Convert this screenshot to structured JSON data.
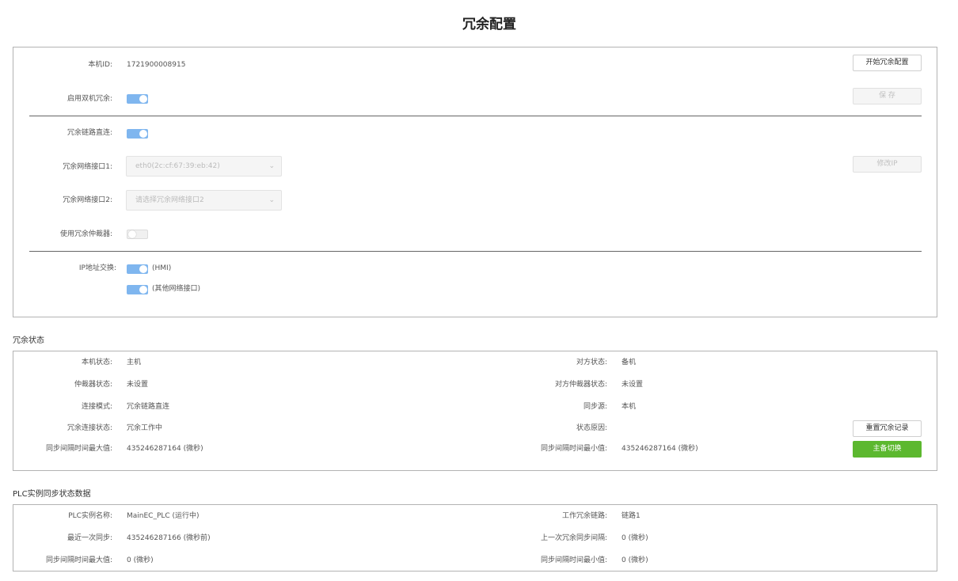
{
  "page_title": "冗余配置",
  "config": {
    "local_id_label": "本机ID:",
    "local_id_value": "1721900008915",
    "start_button": "开始冗余配置",
    "enable_label": "启用双机冗余:",
    "save_button": "保 存",
    "direct_link_label": "冗余链路直连:",
    "iface1_label": "冗余网络接口1:",
    "iface1_value": "eth0(2c:cf:67:39:eb:42)",
    "modify_ip_button": "修改IP",
    "iface2_label": "冗余网络接口2:",
    "iface2_placeholder": "请选择冗余网络接口2",
    "arbiter_label": "使用冗余仲裁器:",
    "ip_swap_label": "IP地址交换:",
    "ip_swap_hmi": "(HMI)",
    "ip_swap_other": "(其他网络接口)",
    "toggles": {
      "enable": true,
      "direct_link": true,
      "arbiter": false,
      "hmi": true,
      "other": true
    }
  },
  "status": {
    "section_title": "冗余状态",
    "local_state_label": "本机状态:",
    "local_state_value": "主机",
    "peer_state_label": "对方状态:",
    "peer_state_value": "备机",
    "arbiter_state_label": "仲裁器状态:",
    "arbiter_state_value": "未设置",
    "peer_arbiter_label": "对方仲裁器状态:",
    "peer_arbiter_value": "未设置",
    "conn_mode_label": "连接模式:",
    "conn_mode_value": "冗余链路直连",
    "sync_source_label": "同步源:",
    "sync_source_value": "本机",
    "conn_state_label": "冗余连接状态:",
    "conn_state_value": "冗余工作中",
    "reason_label": "状态原因:",
    "reset_button": "重置冗余记录",
    "max_interval_label": "同步间隔时间最大值:",
    "max_interval_value": "435246287164 (微秒)",
    "min_interval_label": "同步间隔时间最小值:",
    "min_interval_value": "435246287164 (微秒)",
    "switch_button": "主备切换"
  },
  "plc": {
    "section_title": "PLC实例同步状态数据",
    "name_label": "PLC实例名称:",
    "name_value": "MainEC_PLC (运行中)",
    "link_label": "工作冗余链路:",
    "link_value": "链路1",
    "last_sync_label": "最近一次同步:",
    "last_sync_value": "435246287166 (微秒前)",
    "prev_interval_label": "上一次冗余同步间隔:",
    "prev_interval_value": "0 (微秒)",
    "max_label": "同步间隔时间最大值:",
    "max_value": "0 (微秒)",
    "min_label": "同步间隔时间最小值:",
    "min_value": "0 (微秒)"
  }
}
